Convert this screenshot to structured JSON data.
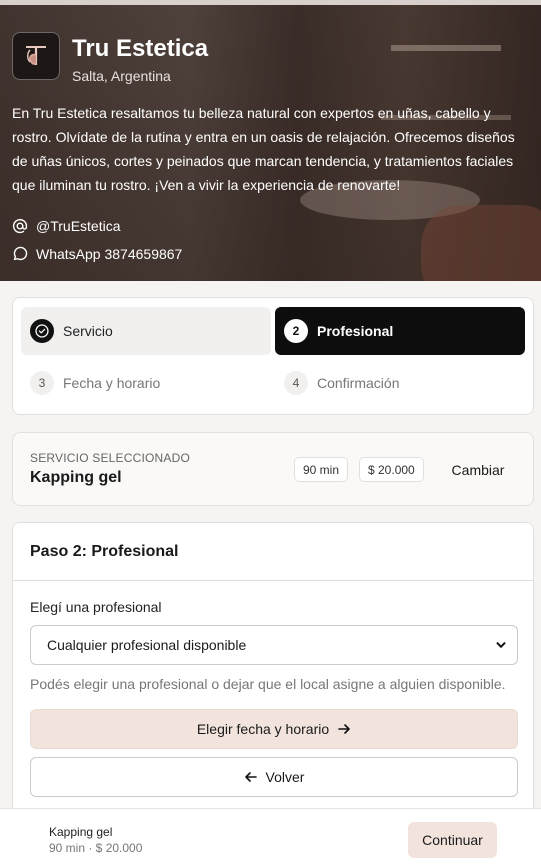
{
  "brand": {
    "name": "Tru Estetica",
    "location": "Salta, Argentina",
    "description": "En Tru Estetica resaltamos tu belleza natural con expertos en uñas, cabello y rostro. Olvídate de la rutina y entra en un oasis de relajación. Ofrecemos diseños de uñas únicos, cortes y peinados que marcan tendencia, y tratamientos faciales que iluminan tu rostro. ¡Ven a vivir la experiencia de renovarte!",
    "instagram": "@TruEstetica",
    "whatsapp": "WhatsApp 3874659867"
  },
  "stepper": {
    "steps": [
      {
        "label": "Servicio",
        "state": "done",
        "icon": "check-circle-icon"
      },
      {
        "number": "2",
        "label": "Profesional",
        "state": "active"
      },
      {
        "number": "3",
        "label": "Fecha y horario",
        "state": "pending"
      },
      {
        "number": "4",
        "label": "Confirmación",
        "state": "pending"
      }
    ]
  },
  "selected_service": {
    "kicker": "SERVICIO SELECCIONADO",
    "name": "Kapping gel",
    "duration": "90 min",
    "price": "$ 20.000",
    "change_label": "Cambiar"
  },
  "step_panel": {
    "title": "Paso 2: Profesional",
    "field_label": "Elegí una profesional",
    "select_value": "Cualquier profesional disponible",
    "hint": "Podés elegir una profesional o dejar que el local asigne a alguien disponible.",
    "primary_label": "Elegir fecha y horario",
    "secondary_label": "Volver"
  },
  "bottom_bar": {
    "service": "Kapping gel",
    "meta": "90 min · $ 20.000",
    "continue_label": "Continuar"
  },
  "colors": {
    "accent_soft": "#f2e4dd",
    "active_step": "#0d0d0d"
  }
}
